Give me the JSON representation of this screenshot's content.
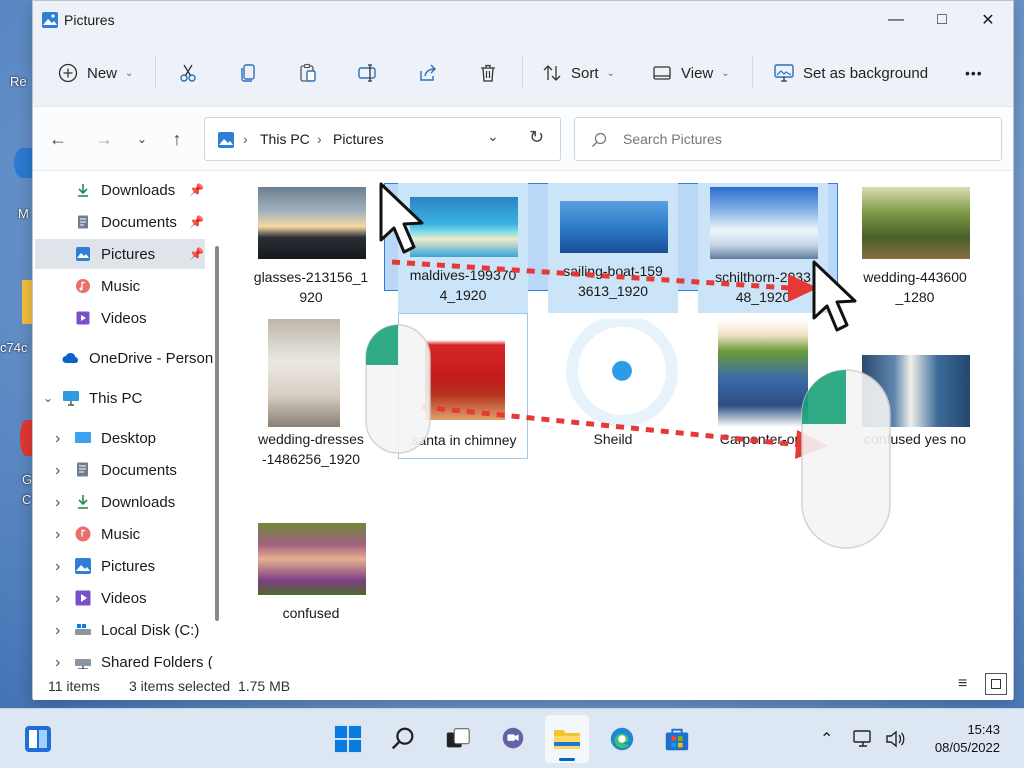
{
  "window": {
    "title": "Pictures"
  },
  "toolbar": {
    "new_label": "New",
    "sort_label": "Sort",
    "view_label": "View",
    "set_bg_label": "Set as background",
    "more_label": "•••"
  },
  "address": {
    "crumbs": [
      "This PC",
      "Pictures"
    ]
  },
  "search": {
    "placeholder": "Search Pictures"
  },
  "sidebar": {
    "quick": [
      {
        "label": "Downloads",
        "pinned": true
      },
      {
        "label": "Documents",
        "pinned": true
      },
      {
        "label": "Pictures",
        "pinned": true,
        "selected": true
      },
      {
        "label": "Music"
      },
      {
        "label": "Videos"
      }
    ],
    "onedrive": "OneDrive - Person",
    "thispc": "This PC",
    "pc_items": [
      "Desktop",
      "Documents",
      "Downloads",
      "Music",
      "Pictures",
      "Videos",
      "Local Disk (C:)",
      "Shared Folders ("
    ]
  },
  "files": [
    {
      "name": "glasses-213156_1920",
      "line1": "glasses-213156_1",
      "line2": "920"
    },
    {
      "name": "maldives-1993704_1920",
      "line1": "maldives-199370",
      "line2": "4_1920",
      "selected": true
    },
    {
      "name": "sailing-boat-1593613_1920",
      "line1": "sailing-boat-159",
      "line2": "3613_1920",
      "selected": true
    },
    {
      "name": "schilthorn-203348_1920",
      "line1": "schilthorn-2033",
      "line2": "48_1920",
      "selected": true
    },
    {
      "name": "wedding-443600_1280",
      "line1": "wedding-443600",
      "line2": "_1280"
    },
    {
      "name": "wedding-dresses-1486256_1920",
      "line1": "wedding-dresses",
      "line2": "-1486256_1920"
    },
    {
      "name": "santa in chimney",
      "line1": "santa in chimney",
      "line2": ""
    },
    {
      "name": "Sheild",
      "line1": "Sheild",
      "line2": ""
    },
    {
      "name": "Carpenter-out",
      "line1": "Carpenter-out",
      "line2": ""
    },
    {
      "name": "confused yes no",
      "line1": "confused yes no",
      "line2": ""
    },
    {
      "name": "confused",
      "line1": "confused",
      "line2": ""
    }
  ],
  "status": {
    "count": "11 items",
    "selected": "3 items selected  1.75 MB"
  },
  "clock": {
    "time": "15:43",
    "date": "08/05/2022"
  },
  "desktop_fragments": [
    "Re",
    "M",
    "c74c",
    "G",
    "C"
  ],
  "colors": {
    "accent": "#0067c0",
    "selection": "#cce4f7",
    "drag_arrow": "#e53935",
    "mouse_button": "#1aa37a"
  }
}
